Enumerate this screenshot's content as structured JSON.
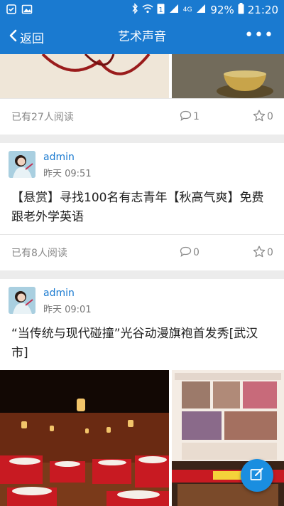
{
  "status_bar": {
    "battery_percent": "92%",
    "time": "21:20",
    "network_label": "4G"
  },
  "navbar": {
    "back_label": "返回",
    "title": "艺术声音",
    "more_label": "•••"
  },
  "posts": [
    {
      "reads_text": "已有27人阅读",
      "comment_count": "1",
      "favorite_count": "0"
    },
    {
      "author": "admin",
      "time": "昨天 09:51",
      "title": "【悬赏】寻找100名有志青年【秋高气爽】免费跟老外学英语",
      "reads_text": "已有8人阅读",
      "comment_count": "0",
      "favorite_count": "0"
    },
    {
      "author": "admin",
      "time": "昨天 09:01",
      "title": "“当传统与现代碰撞”光谷动漫旗袍首发秀[武汉市]"
    }
  ],
  "colors": {
    "brand": "#1a7ad0",
    "link": "#1a7ad0",
    "muted_text": "#888888"
  }
}
